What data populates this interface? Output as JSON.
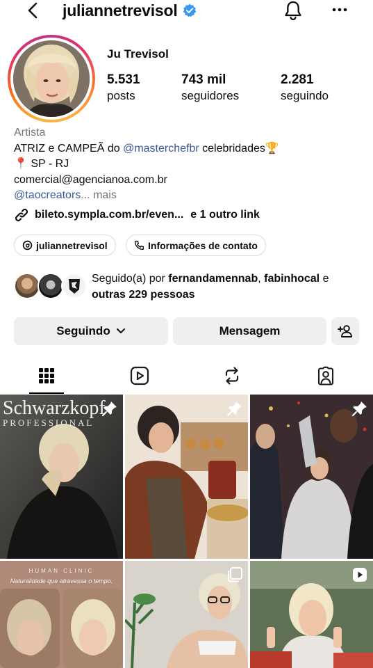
{
  "header": {
    "username": "juliannetrevisol",
    "back_icon": "chevron-left-icon",
    "verified_icon": "verified-badge-icon",
    "bell_icon": "bell-icon",
    "more_icon": "more-horizontal-icon",
    "verified_color": "#3897f0"
  },
  "profile": {
    "full_name": "Ju Trevisol",
    "stats": [
      {
        "value": "5.531",
        "label": "posts"
      },
      {
        "value": "743 mil",
        "label": "seguidores"
      },
      {
        "value": "2.281",
        "label": "seguindo"
      }
    ]
  },
  "bio": {
    "category": "Artista",
    "line1_prefix": "ATRIZ e CAMPEÃ do ",
    "line1_mention": "@masterchefbr",
    "line1_suffix": " celebridades🏆",
    "line2": "📍 SP - RJ",
    "line3": "comercial@agencianoa.com.br",
    "line4_mention": "@taocreators",
    "line4_more": "... mais"
  },
  "links": {
    "url": "bileto.sympla.com.br/even...",
    "more": "e 1 outro link",
    "icon": "link-icon"
  },
  "chips": {
    "threads_label": "juliannetrevisol",
    "threads_icon": "threads-icon",
    "contact_label": "Informações de contato",
    "contact_icon": "phone-icon"
  },
  "followed_by": {
    "prefix": "Seguido(a) por ",
    "user1": "fernandamennab",
    "sep": ", ",
    "user2": "fabinhocal",
    "suffix": " e",
    "others": "outras 229 pessoas"
  },
  "buttons": {
    "following_label": "Seguindo",
    "following_icon": "chevron-down-icon",
    "message_label": "Mensagem",
    "add_user_icon": "add-person-icon"
  },
  "tabs": [
    {
      "name": "posts-grid",
      "icon": "grid-icon",
      "active": true
    },
    {
      "name": "reels",
      "icon": "reels-icon",
      "active": false
    },
    {
      "name": "reposts",
      "icon": "repost-icon",
      "active": false
    },
    {
      "name": "tagged",
      "icon": "tagged-person-icon",
      "active": false
    }
  ],
  "grid": {
    "posts": [
      {
        "badge": "pin-icon",
        "overlay_text": "Schwarzkopf",
        "overlay_sub": "PROFESSIONAL"
      },
      {
        "badge": "pin-icon"
      },
      {
        "badge": "pin-icon"
      },
      {
        "badge": "none",
        "overlay_text": "HUMAN CLINIC",
        "overlay_sub": "Naturalidade que atravessa o tempo."
      },
      {
        "badge": "carousel-icon"
      },
      {
        "badge": "reel-icon"
      }
    ]
  }
}
